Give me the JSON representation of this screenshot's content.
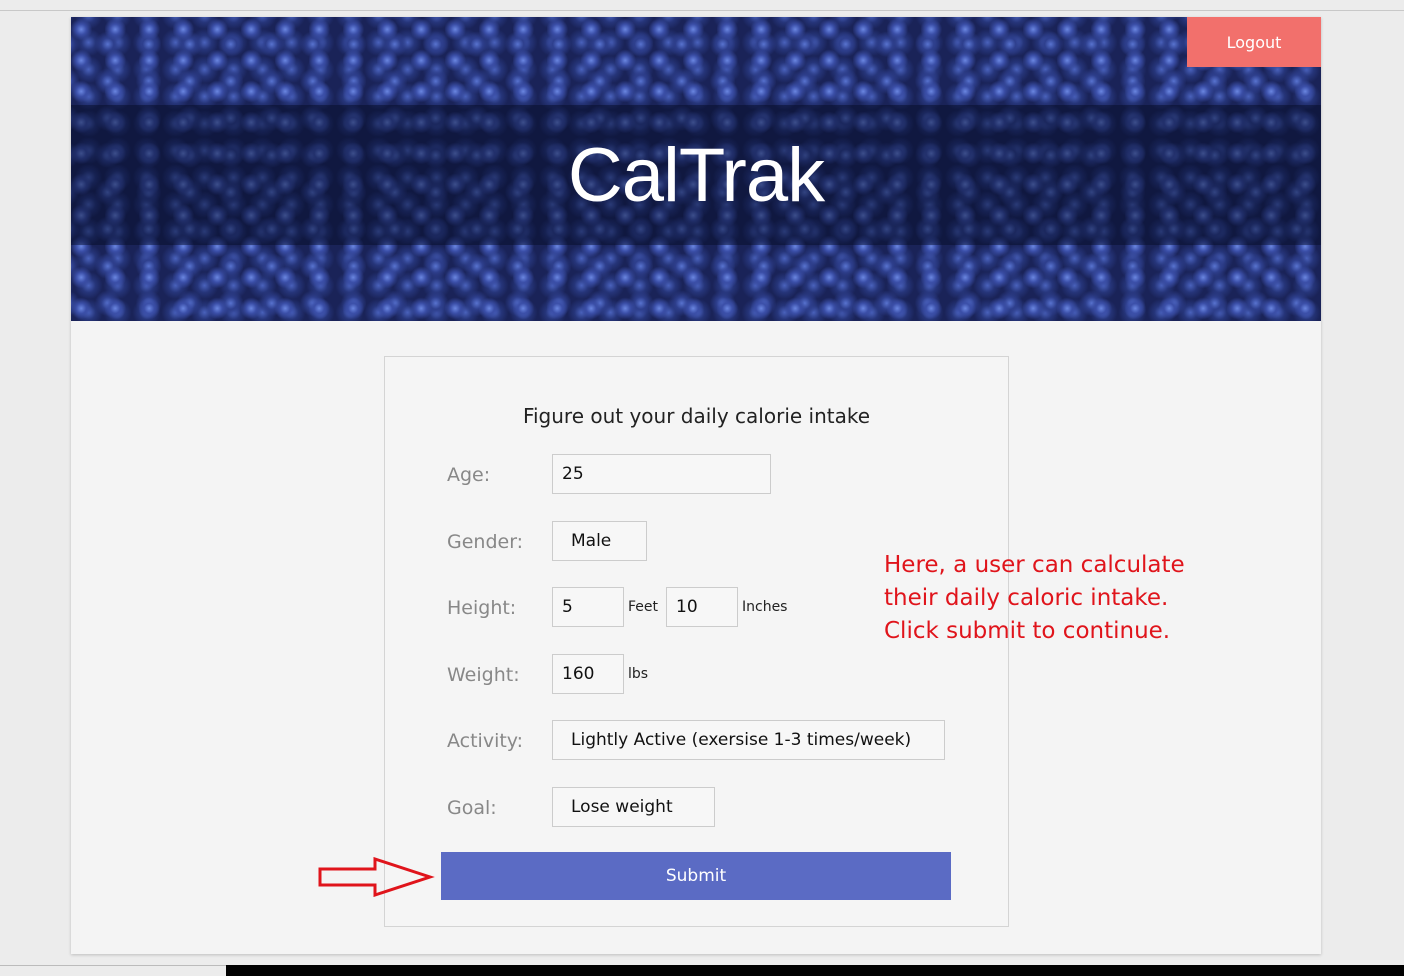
{
  "header": {
    "title": "CalTrak",
    "logout_label": "Logout"
  },
  "form": {
    "heading": "Figure out your daily calorie intake",
    "age": {
      "label": "Age:",
      "value": "25"
    },
    "gender": {
      "label": "Gender:",
      "value": "Male"
    },
    "height": {
      "label": "Height:",
      "feet": "5",
      "feet_unit": "Feet",
      "inches": "10",
      "inches_unit": "Inches"
    },
    "weight": {
      "label": "Weight:",
      "value": "160",
      "unit": "lbs"
    },
    "activity": {
      "label": "Activity:",
      "value": "Lightly Active (exersise 1-3 times/week)"
    },
    "goal": {
      "label": "Goal:",
      "value": "Lose weight"
    },
    "submit_label": "Submit"
  },
  "annotation": {
    "line1": "Here, a user can calculate",
    "line2": "their daily caloric intake.",
    "line3": "Click submit to continue.",
    "color": "#e0141b"
  }
}
